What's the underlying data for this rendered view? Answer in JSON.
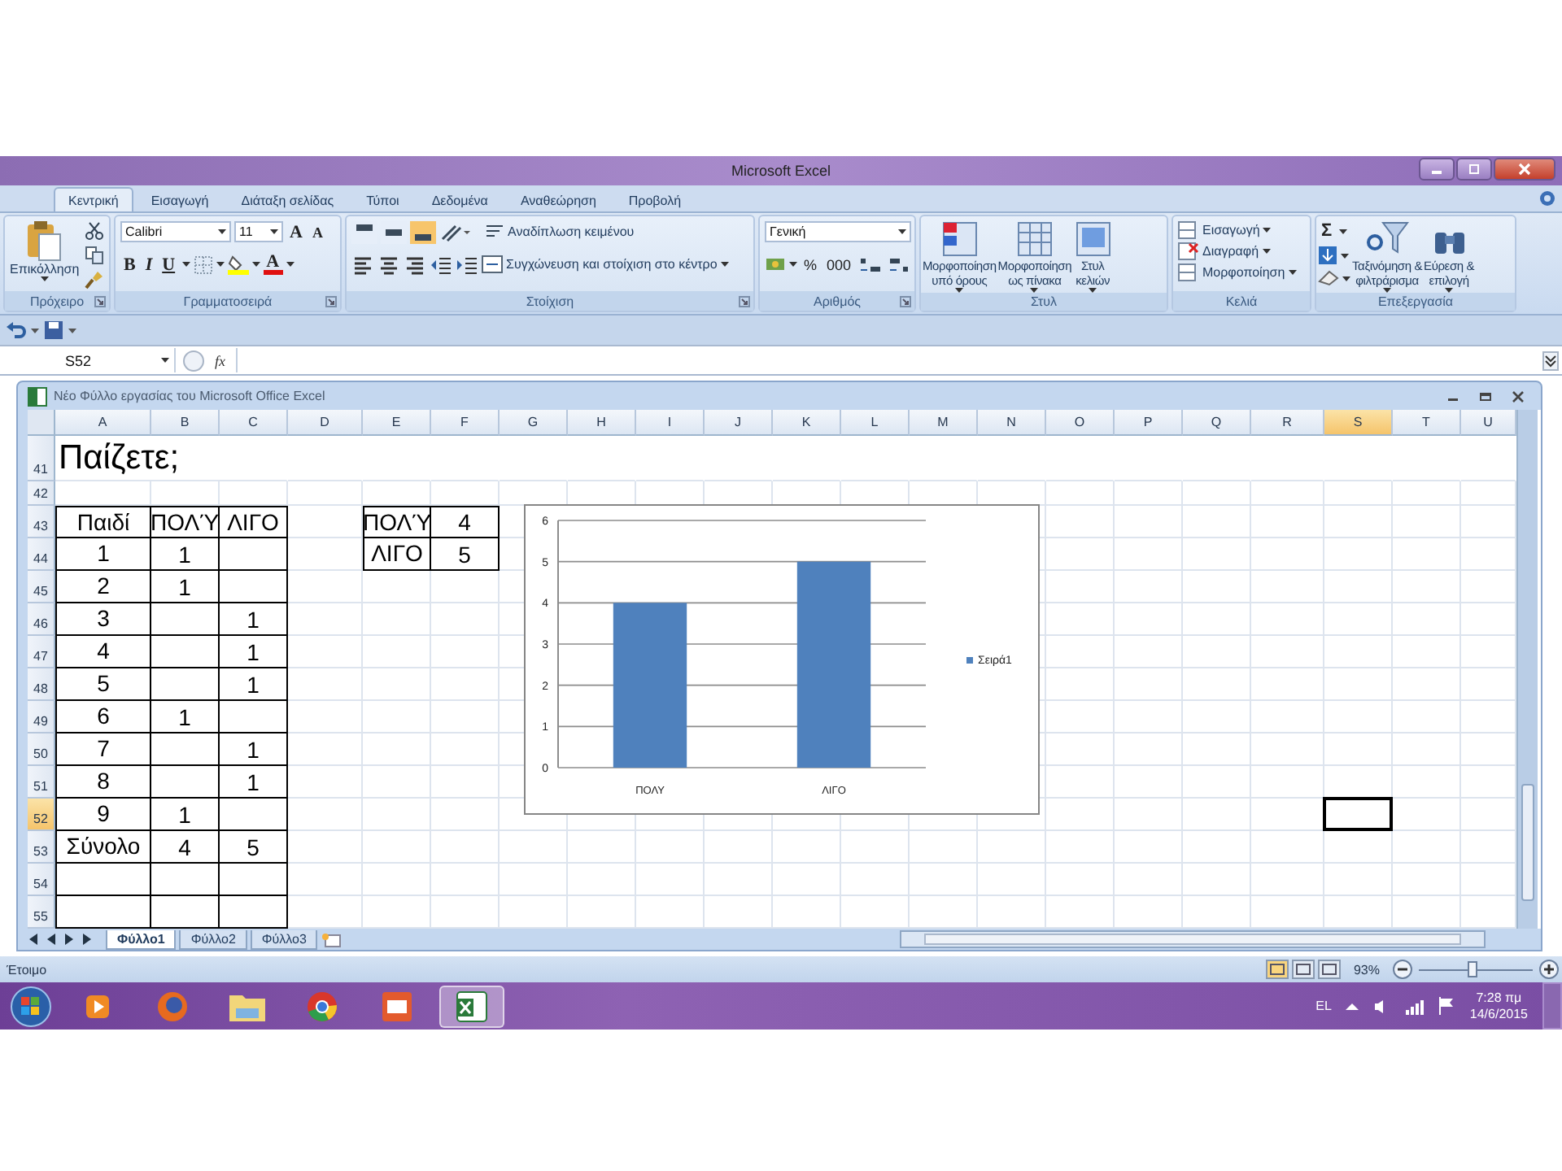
{
  "window": {
    "title": "Microsoft Excel"
  },
  "tabs": [
    {
      "label": "Κεντρική",
      "selected": true
    },
    {
      "label": "Εισαγωγή",
      "selected": false
    },
    {
      "label": "Διάταξη σελίδας",
      "selected": false
    },
    {
      "label": "Τύποι",
      "selected": false
    },
    {
      "label": "Δεδομένα",
      "selected": false
    },
    {
      "label": "Αναθεώρηση",
      "selected": false
    },
    {
      "label": "Προβολή",
      "selected": false
    }
  ],
  "ribbon": {
    "groups": [
      {
        "kind": "clipboard",
        "title": "Πρόχειρο",
        "paste": "Επικόλληση"
      },
      {
        "kind": "font",
        "title": "Γραμματοσειρά",
        "font": "Calibri",
        "size": "11",
        "grow": "A",
        "shrink": "A",
        "bold": "B",
        "italic": "I",
        "underline": "U",
        "color_letter": "A"
      },
      {
        "kind": "alignment",
        "title": "Στοίχιση",
        "vertical_align": [
          {
            "selected": false
          },
          {
            "selected": false
          },
          {
            "selected": true
          }
        ],
        "wrap": "Αναδίπλωση κειμένου",
        "merge": "Συγχώνευση και στοίχιση στο κέντρο"
      },
      {
        "kind": "number",
        "title": "Αριθμός",
        "format": "Γενική",
        "percent": "%",
        "thousands": "000"
      },
      {
        "kind": "styles",
        "title": "Στυλ",
        "buttons": [
          "Μορφοποίηση\nυπό όρους",
          "Μορφοποίηση\nως πίνακα",
          "Στυλ\nκελιών"
        ]
      },
      {
        "kind": "cells",
        "title": "Κελιά",
        "buttons": [
          "Εισαγωγή",
          "Διαγραφή",
          "Μορφοποίηση"
        ]
      },
      {
        "kind": "editing",
        "title": "Επεξεργασία",
        "sum": "Σ",
        "buttons": [
          "Ταξινόμηση &\nφιλτράρισμα",
          "Εύρεση &\nεπιλογή"
        ]
      }
    ]
  },
  "name_box": "S52",
  "function_label": "fx",
  "workbook": {
    "title": "Νέο Φύλλο εργασίας του Microsoft Office Excel",
    "columns": [
      {
        "label": "A",
        "selected": false
      },
      {
        "label": "B",
        "selected": false
      },
      {
        "label": "C",
        "selected": false
      },
      {
        "label": "D",
        "selected": false
      },
      {
        "label": "E",
        "selected": false
      },
      {
        "label": "F",
        "selected": false
      },
      {
        "label": "G",
        "selected": false
      },
      {
        "label": "H",
        "selected": false
      },
      {
        "label": "I",
        "selected": false
      },
      {
        "label": "J",
        "selected": false
      },
      {
        "label": "K",
        "selected": false
      },
      {
        "label": "L",
        "selected": false
      },
      {
        "label": "M",
        "selected": false
      },
      {
        "label": "N",
        "selected": false
      },
      {
        "label": "O",
        "selected": false
      },
      {
        "label": "P",
        "selected": false
      },
      {
        "label": "Q",
        "selected": false
      },
      {
        "label": "R",
        "selected": false
      },
      {
        "label": "S",
        "selected": true
      },
      {
        "label": "T",
        "selected": false
      },
      {
        "label": "U",
        "selected": false
      }
    ],
    "rows": [
      {
        "number": "41",
        "kind": "title",
        "selected": false,
        "cells": [
          {
            "text": "Παίζετε;",
            "boxed": false
          }
        ]
      },
      {
        "number": "42",
        "kind": "blank",
        "selected": false,
        "cells": []
      },
      {
        "number": "43",
        "kind": "data",
        "selected": false,
        "cells": [
          {
            "text": "Παιδί",
            "boxed": true
          },
          {
            "text": "ΠΟΛΎ",
            "boxed": true
          },
          {
            "text": "ΛΙΓΟ",
            "boxed": true
          },
          null,
          {
            "text": "ΠΟΛΎ",
            "boxed": true
          },
          {
            "text": "4",
            "boxed": true
          }
        ]
      },
      {
        "number": "44",
        "kind": "data",
        "selected": false,
        "cells": [
          {
            "text": "1",
            "boxed": true
          },
          {
            "text": "1",
            "boxed": true
          },
          {
            "boxed": true
          },
          null,
          {
            "text": "ΛΙΓΟ",
            "boxed": true
          },
          {
            "text": "5",
            "boxed": true
          }
        ]
      },
      {
        "number": "45",
        "kind": "data",
        "selected": false,
        "cells": [
          {
            "text": "2",
            "boxed": true
          },
          {
            "text": "1",
            "boxed": true
          },
          {
            "boxed": true
          }
        ]
      },
      {
        "number": "46",
        "kind": "data",
        "selected": false,
        "cells": [
          {
            "text": "3",
            "boxed": true
          },
          {
            "boxed": true
          },
          {
            "text": "1",
            "boxed": true
          }
        ]
      },
      {
        "number": "47",
        "kind": "data",
        "selected": false,
        "cells": [
          {
            "text": "4",
            "boxed": true
          },
          {
            "boxed": true
          },
          {
            "text": "1",
            "boxed": true
          }
        ]
      },
      {
        "number": "48",
        "kind": "data",
        "selected": false,
        "cells": [
          {
            "text": "5",
            "boxed": true
          },
          {
            "boxed": true
          },
          {
            "text": "1",
            "boxed": true
          }
        ]
      },
      {
        "number": "49",
        "kind": "data",
        "selected": false,
        "cells": [
          {
            "text": "6",
            "boxed": true
          },
          {
            "text": "1",
            "boxed": true
          },
          {
            "boxed": true
          }
        ]
      },
      {
        "number": "50",
        "kind": "data",
        "selected": false,
        "cells": [
          {
            "text": "7",
            "boxed": true
          },
          {
            "boxed": true
          },
          {
            "text": "1",
            "boxed": true
          }
        ]
      },
      {
        "number": "51",
        "kind": "data",
        "selected": false,
        "cells": [
          {
            "text": "8",
            "boxed": true
          },
          {
            "boxed": true
          },
          {
            "text": "1",
            "boxed": true
          }
        ]
      },
      {
        "number": "52",
        "kind": "data",
        "selected": true,
        "cells": [
          {
            "text": "9",
            "boxed": true
          },
          {
            "text": "1",
            "boxed": true
          },
          {
            "boxed": true
          }
        ]
      },
      {
        "number": "53",
        "kind": "data",
        "selected": false,
        "cells": [
          {
            "text": "Σύνολο",
            "boxed": true
          },
          {
            "text": "4",
            "boxed": true
          },
          {
            "text": "5",
            "boxed": true
          }
        ]
      },
      {
        "number": "54",
        "kind": "data",
        "selected": false,
        "cells": [
          {
            "boxed": true
          },
          {
            "boxed": true
          },
          {
            "boxed": true
          }
        ]
      },
      {
        "number": "55",
        "kind": "data",
        "selected": false,
        "cells": [
          {
            "boxed": true
          },
          {
            "boxed": true
          },
          {
            "boxed": true
          }
        ]
      }
    ],
    "chart": {
      "chart_data": {
        "type": "bar",
        "grid": true,
        "categories": [
          "ΠΟΛΥ",
          "ΛΙΓΟ"
        ],
        "series": [
          {
            "name": "Σειρά1",
            "color": "#4f81bd",
            "values": [
              4,
              5
            ]
          }
        ],
        "ylim": [
          0,
          6
        ],
        "yticks": [
          0,
          1,
          2,
          3,
          4,
          5,
          6
        ]
      }
    },
    "sheets": [
      {
        "label": "Φύλλο1",
        "selected": true
      },
      {
        "label": "Φύλλο2",
        "selected": false
      },
      {
        "label": "Φύλλο3",
        "selected": false
      }
    ]
  },
  "status_bar": {
    "text": "Έτοιμο",
    "views": [
      {
        "selected": true
      },
      {
        "selected": false
      },
      {
        "selected": false
      }
    ],
    "zoom": "93%",
    "zoom_slider": {
      "level": 0.47
    }
  },
  "taskbar": {
    "apps": [
      {
        "kind": "media",
        "selected": false
      },
      {
        "kind": "firefox",
        "selected": false
      },
      {
        "kind": "folder",
        "selected": false
      },
      {
        "kind": "chrome",
        "selected": false
      },
      {
        "kind": "powerpoint",
        "selected": false
      },
      {
        "kind": "excel",
        "selected": true
      }
    ],
    "language": "EL",
    "time": "7:28 πμ",
    "date": "14/6/2015"
  }
}
